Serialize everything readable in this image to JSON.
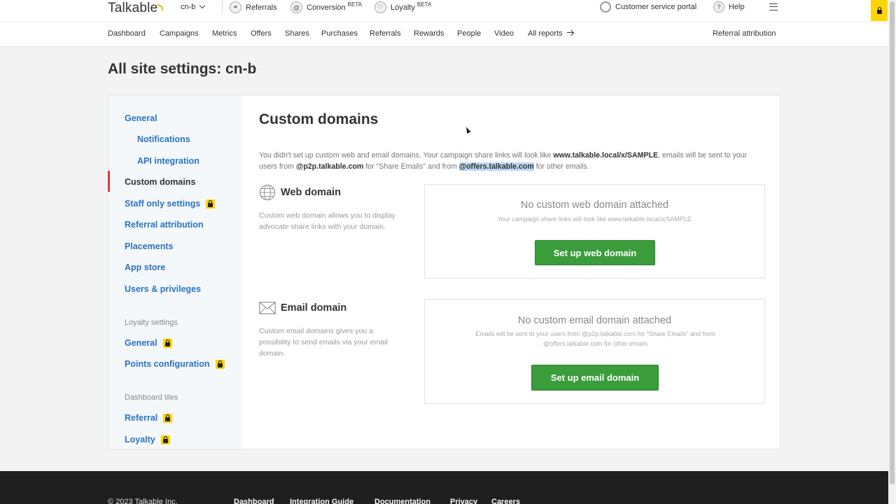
{
  "topbar": {
    "logo": "Talkable",
    "site": "cn-b",
    "products": [
      {
        "label": "Referrals",
        "badge": ""
      },
      {
        "label": "Conversion",
        "badge": "BETA"
      },
      {
        "label": "Loyalty",
        "badge": "BETA"
      }
    ],
    "customer_portal": "Customer service portal",
    "help": "Help"
  },
  "nav": {
    "items": [
      "Dashboard",
      "Campaigns",
      "Metrics",
      "Offers",
      "Shares",
      "Purchases",
      "Referrals",
      "Rewards",
      "People",
      "Video",
      "All reports"
    ],
    "right": "Referral attribution"
  },
  "page_title": "All site settings: cn-b",
  "sidebar": {
    "items": [
      {
        "label": "General",
        "locked": false
      },
      {
        "label": "Notifications",
        "locked": false
      },
      {
        "label": "API integration",
        "locked": false
      },
      {
        "label": "Custom domains",
        "locked": false,
        "active": true
      },
      {
        "label": "Staff only settings",
        "locked": true
      },
      {
        "label": "Referral attribution",
        "locked": false
      },
      {
        "label": "Placements",
        "locked": false
      },
      {
        "label": "App store",
        "locked": false
      },
      {
        "label": "Users & privileges",
        "locked": false
      }
    ],
    "loyalty_heading": "Loyalty settings",
    "loyalty_items": [
      {
        "label": "General",
        "locked": true
      },
      {
        "label": "Points configuration",
        "locked": true
      }
    ],
    "tiles_heading": "Dashboard tiles",
    "tiles_items": [
      {
        "label": "Referral",
        "locked": true
      },
      {
        "label": "Loyalty",
        "locked": true
      }
    ]
  },
  "content": {
    "title": "Custom domains",
    "intro": {
      "p1": "You didn't set up custom web and email domains. Your campaign share links will look like ",
      "url": "www.talkable.local/x/SAMPLE",
      "p2": ", emails will be sent to your users from ",
      "email1": "@p2p.talkable.com",
      "p3": " for \"Share Emails\" and from ",
      "email2": "@offers.talkable.com",
      "p4": " for other emails."
    },
    "web": {
      "title": "Web domain",
      "desc": "Custom web domain allows you to display advocate share links with your domain.",
      "box_title": "No custom web domain attached",
      "box_sub": "Your campaign share links will look like www.talkable.local/x/SAMPLE.",
      "button": "Set up web domain"
    },
    "email": {
      "title": "Email domain",
      "desc": "Custom email domains gives you a possibility to send emails via your email domain.",
      "box_title": "No custom email domain attached",
      "box_sub": "Emails will be sent to your users from @p2p.talkable.com for \"Share Emails\" and from @offers.talkable.com for other emails",
      "button": "Set up email domain"
    }
  },
  "footer": {
    "copyright": "© 2023 Talkable Inc.",
    "links": [
      "Dashboard",
      "Integration Guide",
      "Documentation",
      "Privacy",
      "Careers"
    ]
  },
  "colors": {
    "accent_blue": "#2a72c4",
    "button_green": "#3a9c3a",
    "lock_yellow": "#ffd400",
    "active_red": "#e03a3a"
  }
}
